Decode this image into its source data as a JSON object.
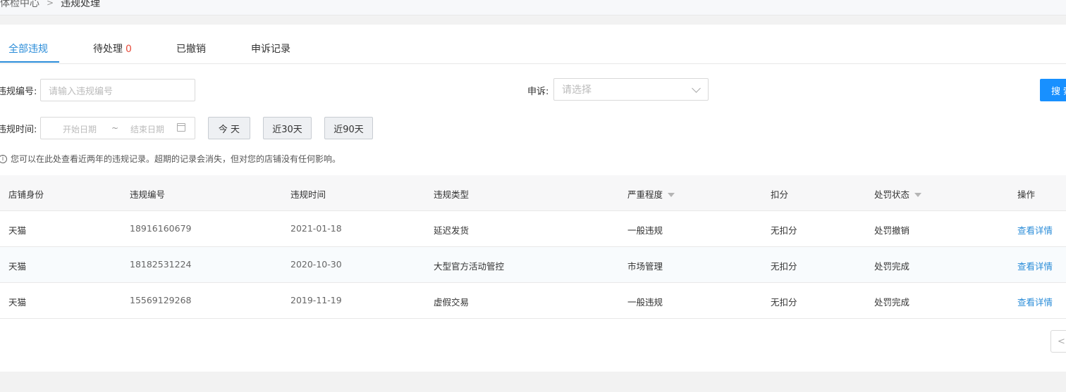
{
  "breadcrumb": {
    "parent": "体检中心",
    "separator": ">",
    "current": "违规处理"
  },
  "tabs": [
    {
      "label": "全部违规",
      "active": true
    },
    {
      "label": "待处理",
      "count": "0"
    },
    {
      "label": "已撤销"
    },
    {
      "label": "申诉记录"
    }
  ],
  "filters": {
    "violation_no_label": "违规编号:",
    "violation_no_placeholder": "请输入违规编号",
    "appeal_label": "申诉:",
    "appeal_placeholder": "请选择",
    "search_label": "搜索",
    "time_label": "违规时间:",
    "start_placeholder": "开始日期",
    "range_sep": "~",
    "end_placeholder": "结束日期",
    "quick": [
      "今 天",
      "近30天",
      "近90天"
    ]
  },
  "notice": "您可以在此处查看近两年的违规记录。超期的记录会消失，但对您的店铺没有任何影响。",
  "table": {
    "columns": [
      "店铺身份",
      "违规编号",
      "违规时间",
      "违规类型",
      "严重程度",
      "扣分",
      "处罚状态",
      "操作"
    ],
    "rows": [
      [
        "天猫",
        "18916160679",
        "2021-01-18",
        "延迟发货",
        "一般违规",
        "无扣分",
        "处罚撤销",
        "查看详情"
      ],
      [
        "天猫",
        "18182531224",
        "2020-10-30",
        "大型官方活动管控",
        "市场管理",
        "无扣分",
        "处罚完成",
        "查看详情"
      ],
      [
        "天猫",
        "15569129268",
        "2019-11-19",
        "虚假交易",
        "一般违规",
        "无扣分",
        "处罚完成",
        "查看详情"
      ]
    ]
  },
  "pager": {
    "prev_label": "<"
  },
  "colors": {
    "accent": "#2a8cd8",
    "primary_button": "#1890ff",
    "count": "#e74c3c"
  }
}
